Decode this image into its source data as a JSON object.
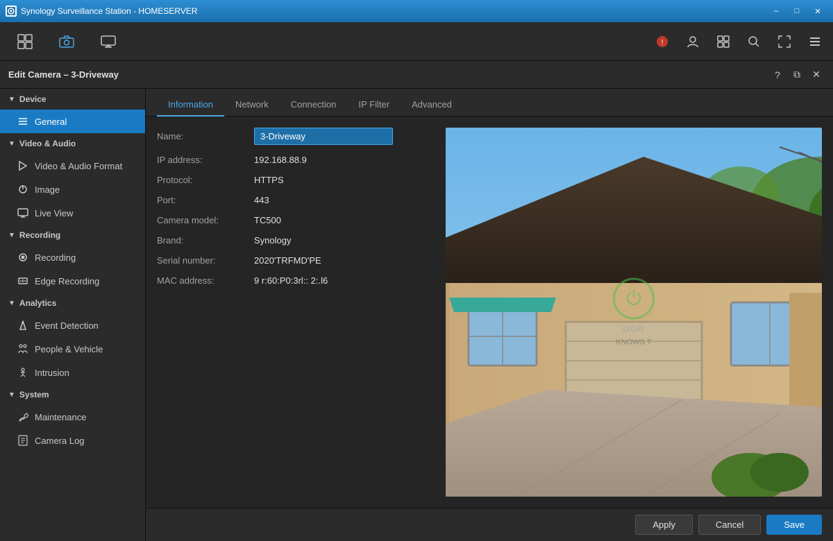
{
  "titlebar": {
    "title": "Synology Surveillance Station - HOMESERVER",
    "controls": {
      "minimize": "–",
      "maximize": "□",
      "close": "✕"
    }
  },
  "toolbar": {
    "buttons": [
      {
        "id": "overview",
        "icon": "⊞",
        "label": ""
      },
      {
        "id": "camera",
        "icon": "📷",
        "label": ""
      },
      {
        "id": "monitor",
        "icon": "🎥",
        "label": ""
      }
    ],
    "right_buttons": [
      {
        "id": "notifications",
        "icon": "🔔"
      },
      {
        "id": "account",
        "icon": "👤"
      },
      {
        "id": "layout",
        "icon": "⊞"
      },
      {
        "id": "search",
        "icon": "🔍"
      },
      {
        "id": "fullscreen",
        "icon": "⤢"
      },
      {
        "id": "menu",
        "icon": "☰"
      }
    ]
  },
  "edit_camera": {
    "title": "Edit Camera – 3-Driveway",
    "header_buttons": {
      "help": "?",
      "restore": "⧉",
      "close": "✕"
    }
  },
  "sidebar": {
    "sections": [
      {
        "id": "device",
        "label": "Device",
        "items": [
          {
            "id": "general",
            "icon": "≡",
            "label": "General",
            "active": true
          }
        ]
      },
      {
        "id": "video-audio",
        "label": "Video & Audio",
        "items": [
          {
            "id": "video-audio-format",
            "icon": "▶",
            "label": "Video & Audio Format"
          },
          {
            "id": "image",
            "icon": "☀",
            "label": "Image"
          },
          {
            "id": "live-view",
            "icon": "📺",
            "label": "Live View"
          }
        ]
      },
      {
        "id": "recording",
        "label": "Recording",
        "items": [
          {
            "id": "recording",
            "icon": "⏺",
            "label": "Recording"
          },
          {
            "id": "edge-recording",
            "icon": "💾",
            "label": "Edge Recording"
          }
        ]
      },
      {
        "id": "analytics",
        "label": "Analytics",
        "items": [
          {
            "id": "event-detection",
            "icon": "🔔",
            "label": "Event Detection"
          },
          {
            "id": "people-vehicle",
            "icon": "👥",
            "label": "People & Vehicle"
          },
          {
            "id": "intrusion",
            "icon": "🚶",
            "label": "Intrusion"
          }
        ]
      },
      {
        "id": "system",
        "label": "System",
        "items": [
          {
            "id": "maintenance",
            "icon": "🔧",
            "label": "Maintenance"
          },
          {
            "id": "camera-log",
            "icon": "📋",
            "label": "Camera Log"
          }
        ]
      }
    ]
  },
  "tabs": [
    {
      "id": "information",
      "label": "Information",
      "active": true
    },
    {
      "id": "network",
      "label": "Network",
      "active": false
    },
    {
      "id": "connection",
      "label": "Connection",
      "active": false
    },
    {
      "id": "ip-filter",
      "label": "IP Filter",
      "active": false
    },
    {
      "id": "advanced",
      "label": "Advanced",
      "active": false
    }
  ],
  "form": {
    "fields": [
      {
        "id": "name",
        "label": "Name:",
        "value": "3-Driveway",
        "is_input": true
      },
      {
        "id": "ip-address",
        "label": "IP address:",
        "value": "192.168.88.9",
        "is_input": false
      },
      {
        "id": "protocol",
        "label": "Protocol:",
        "value": "HTTPS",
        "is_input": false
      },
      {
        "id": "port",
        "label": "Port:",
        "value": "443",
        "is_input": false
      },
      {
        "id": "camera-model",
        "label": "Camera model:",
        "value": "TC500",
        "is_input": false
      },
      {
        "id": "brand",
        "label": "Brand:",
        "value": "Synology",
        "is_input": false
      },
      {
        "id": "serial-number",
        "label": "Serial number:",
        "value": "2020'TRFMD'PE",
        "is_input": false
      },
      {
        "id": "mac-address",
        "label": "MAC address:",
        "value": "9 r:60:P0:3rl:: 2:.l6",
        "is_input": false
      }
    ]
  },
  "footer": {
    "apply_label": "Apply",
    "cancel_label": "Cancel",
    "save_label": "Save"
  },
  "camera_preview": {
    "watermark_text": "DON",
    "watermark_sub": "KNOWS T"
  }
}
